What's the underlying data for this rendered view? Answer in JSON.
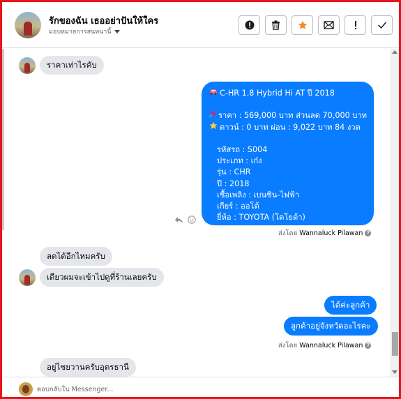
{
  "header": {
    "title": "รักของฉัน เธออย่าปันให้ใคร",
    "assign_label": "มอบหมายการสนทนานี้",
    "toolbar": [
      {
        "name": "mark-spam-button",
        "icon": "exclamation-circle-icon"
      },
      {
        "name": "delete-button",
        "icon": "trash-icon"
      },
      {
        "name": "star-button",
        "icon": "star-icon"
      },
      {
        "name": "mark-unread-button",
        "icon": "envelope-icon"
      },
      {
        "name": "follow-up-button",
        "icon": "exclamation-icon"
      },
      {
        "name": "mark-done-button",
        "icon": "check-icon"
      }
    ]
  },
  "messages": {
    "m1": "ราคาเท่าไรคับ",
    "listing": {
      "title": "C-HR 1.8 Hybrid Hi AT  ปี 2018",
      "title_icon": "car-icon",
      "price": "ราคา : 569,000 บาท  ส่วนลด 70,000  บาท",
      "price_icon": "pushpin-icon",
      "down": "ดาวน์ : 0 บาท ผ่อน :  9,022  บาท 84 งวด",
      "down_icon": "star-icon",
      "code": "รหัสรถ : S004",
      "type": "ประเภท : เก๋ง",
      "model": "รุ่น : CHR",
      "year": "ปี : 2018",
      "fuel": "เชื้อเพลิง : เบนซิน-ไฟฟ้า",
      "gear": "เกียร์ : ออโต้",
      "brand": "ยี่ห้อ : TOYOTA (โตโยต้า)"
    },
    "sent_by_prefix": "ส่งโดย",
    "agent_name": "Wannaluck Pilawan",
    "m2": "ลดได้อีกไหมครับ",
    "m3": "เดียวผมจะเข้าไปดูที่ร้านเลยครับ",
    "r1": "ได้ค่ะลูกค้า",
    "r2": "ลูกค้าอยู่จังหวัดอะไรคะ",
    "m4": "อยู่ไชยวานครับอุดรธานี"
  },
  "composer": {
    "placeholder": "ตอบกลับใน Messenger..."
  },
  "colors": {
    "frame": "#e8141a",
    "outgoing_bubble": "#0a7cff",
    "incoming_bubble": "#e4e6eb",
    "star": "#f28c28"
  }
}
